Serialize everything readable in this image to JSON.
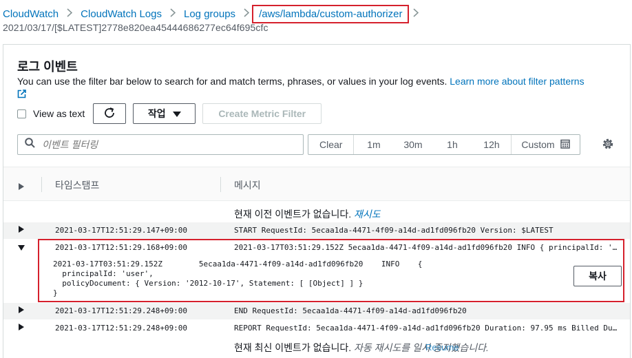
{
  "breadcrumb": {
    "items": [
      "CloudWatch",
      "CloudWatch Logs",
      "Log groups",
      "/aws/lambda/custom-authorizer"
    ],
    "stream": "2021/03/17/[$LATEST]2778e820ea45444686277ec64f695cfc"
  },
  "panel": {
    "title": "로그 이벤트",
    "description": "You can use the filter bar below to search for and match terms, phrases, or values in your log events. ",
    "learn_more": "Learn more about filter patterns"
  },
  "toolbar": {
    "view_as_text": "View as text",
    "actions_label": "작업",
    "create_metric_filter": "Create Metric Filter"
  },
  "filter": {
    "placeholder": "이벤트 필터링",
    "time_buttons": [
      "Clear",
      "1m",
      "30m",
      "1h",
      "12h"
    ],
    "custom_label": "Custom"
  },
  "table": {
    "headers": {
      "timestamp": "타임스탬프",
      "message": "메시지"
    },
    "no_older_prefix": "현재 이전 이벤트가 없습니다. ",
    "no_older_link": "재시도",
    "no_newer_prefix": "현재 최신 이벤트가 없습니다. ",
    "no_newer_italic": "자동 재시도를 일시 중지했습니다.",
    "no_newer_overlay": "Resume",
    "rows": [
      {
        "timestamp": "2021-03-17T12:51:29.147+09:00",
        "message": "START RequestId: 5ecaa1da-4471-4f09-a14d-ad1fd096fb20 Version: $LATEST"
      },
      {
        "timestamp": "2021-03-17T12:51:29.168+09:00",
        "message": "2021-03-17T03:51:29.152Z 5ecaa1da-4471-4f09-a14d-ad1fd096fb20 INFO { principalId: '…"
      },
      {
        "timestamp": "2021-03-17T12:51:29.248+09:00",
        "message": "END RequestId: 5ecaa1da-4471-4f09-a14d-ad1fd096fb20"
      },
      {
        "timestamp": "2021-03-17T12:51:29.248+09:00",
        "message": "REPORT RequestId: 5ecaa1da-4471-4f09-a14d-ad1fd096fb20 Duration: 97.95 ms Billed Du…"
      }
    ],
    "expanded_text": "2021-03-17T03:51:29.152Z        5ecaa1da-4471-4f09-a14d-ad1fd096fb20    INFO    {\n  principalId: 'user',\n  policyDocument: { Version: '2012-10-17', Statement: [ [Object] ] }\n}",
    "copy_label": "복사"
  }
}
